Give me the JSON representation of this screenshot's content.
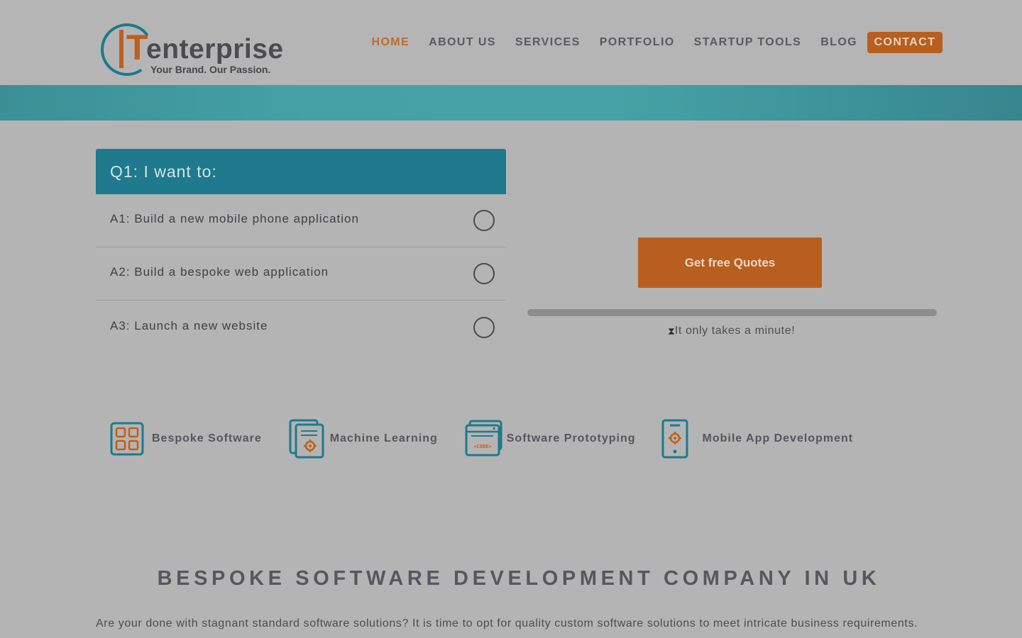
{
  "header": {
    "logo": {
      "letter_i": "I",
      "letter_t": "T",
      "word": "enterprise",
      "tagline": "Your Brand. Our Passion."
    },
    "nav": [
      {
        "label": "HOME",
        "active": true
      },
      {
        "label": "ABOUT US",
        "active": false
      },
      {
        "label": "SERVICES",
        "active": false
      },
      {
        "label": "PORTFOLIO",
        "active": false
      },
      {
        "label": "STARTUP TOOLS",
        "active": false
      },
      {
        "label": "BLOG",
        "active": false
      }
    ],
    "contact_label": "CONTACT"
  },
  "quiz": {
    "question": "Q1: I want to:",
    "options": [
      {
        "label": "A1: Build a new mobile phone application"
      },
      {
        "label": "A2: Build a bespoke web application"
      },
      {
        "label": "A3: Launch a new website"
      }
    ],
    "cta_label": "Get free Quotes",
    "progress_fraction": 0,
    "hourglass_icon": "hourglass-icon",
    "hint": "It only takes a minute!"
  },
  "services": [
    {
      "label": "Bespoke Software",
      "icon": "grid-apps-icon"
    },
    {
      "label": "Machine Learning",
      "icon": "document-gear-icon"
    },
    {
      "label": "Software Prototyping",
      "icon": "code-window-icon"
    },
    {
      "label": "Mobile App Development",
      "icon": "mobile-gear-icon"
    }
  ],
  "section": {
    "title": "BESPOKE SOFTWARE DEVELOPMENT COMPANY IN UK",
    "paragraph": "Are your done with stagnant standard software solutions? It is time to opt for quality custom software solutions to meet intricate business requirements."
  },
  "colors": {
    "teal": "#1e7a8c",
    "orange": "#b85e1e",
    "background": "#b4b4b4"
  }
}
